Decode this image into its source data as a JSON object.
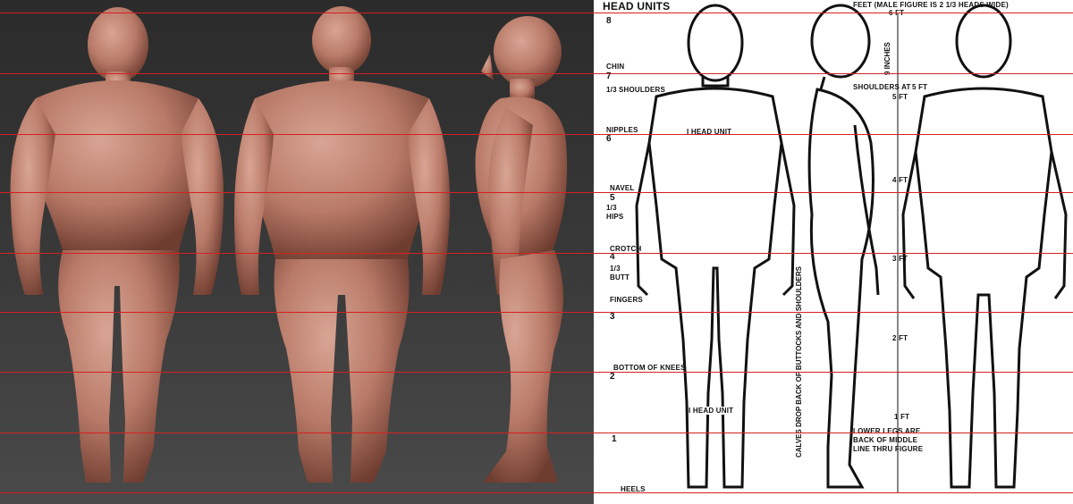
{
  "title": "HEAD UNITS",
  "feet_note": "FEET (MALE FIGURE IS 2 1/3 HEADS WIDE)",
  "head_numbers": [
    "8",
    "7",
    "6",
    "5",
    "4",
    "3",
    "2",
    "1"
  ],
  "body_labels": {
    "chin": "CHIN",
    "shoulders": "SHOULDERS",
    "nipples": "NIPPLES",
    "navel": "NAVEL",
    "hips": "HIPS",
    "crotch": "CROTCH",
    "butt": "BUTT",
    "fingers": "FINGERS",
    "bottom_of_knees": "BOTTOM OF KNEES",
    "heels": "HEELS",
    "third_a": "1/3",
    "third_b": "1/3",
    "third_c": "1/3"
  },
  "annotations": {
    "head_unit_1": "I HEAD UNIT",
    "head_unit_2": "I HEAD UNIT",
    "nine_inches": "9 INCHES",
    "shoulders_at": "SHOULDERS AT",
    "five_ft_note": "5 FT",
    "calves_note": "CALVES DROP BACK OF BUTTOCKS AND SHOULDERS",
    "lower_legs": "LOWER LEGS ARE BACK OF MIDDLE LINE THRU FIGURE"
  },
  "feet_marks": [
    "6 FT",
    "5 FT",
    "4 FT",
    "3 FT",
    "2 FT",
    "1 FT"
  ],
  "colors": {
    "guide_line": "#d62020",
    "sculpt_skin": "#b97a68",
    "ink": "#111111"
  }
}
